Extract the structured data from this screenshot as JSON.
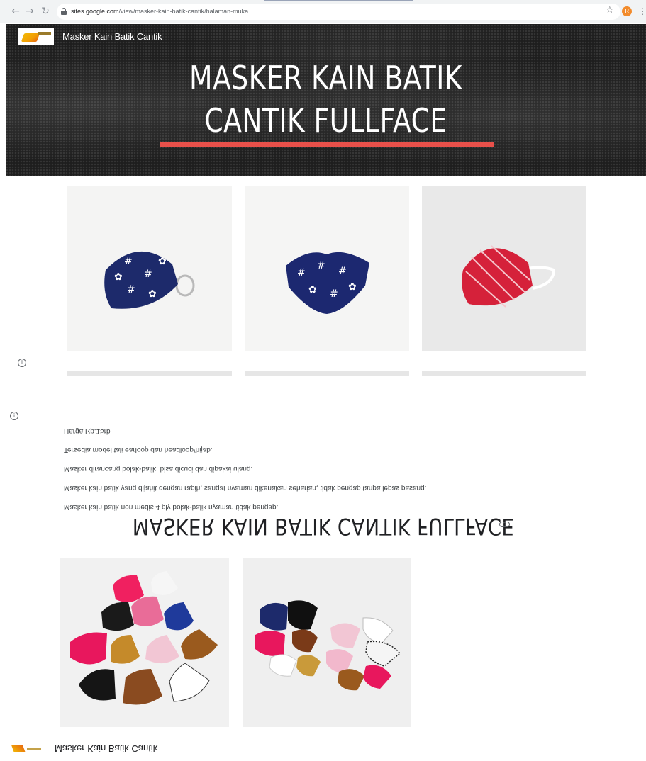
{
  "browser": {
    "url_host": "sites.google.com",
    "url_path": "/view/masker-kain-batik-cantik/halaman-muka",
    "profile_initial": "R",
    "nav_icons": [
      "back-arrow-icon",
      "forward-arrow-icon",
      "reload-icon",
      "lock-icon",
      "star-icon",
      "kebab-menu-icon"
    ]
  },
  "header": {
    "site_title": "Masker Kain Batik Cantik",
    "hero_title_line1": "MASKER KAIN BATIK",
    "hero_title_line2": "CANTIK FULLFACE",
    "accent_color": "#e8504a"
  },
  "products": [
    {
      "label": "navy batik mask with ring ear loop"
    },
    {
      "label": "navy batik mask flat"
    },
    {
      "label": "red parang batik mask"
    }
  ],
  "content": {
    "heading": "MASKER KAIN BATIK CANTIK FULLFACE",
    "descriptions": [
      "Masker kain batik non medis 4 ply bolak-balik nyaman tidak pengap.",
      "Masker kain batik yang dijahit dengan rapih, sangat nyaman dikenakan seharian, tidak pengap tanpa lepas pasang.",
      "Masker dirancang bolak-balik, bisa dicuci dan dipakai ulang.",
      "Tersedia model tali earloop dan headloop/hijab.",
      "Harga Rp.15rb"
    ]
  },
  "footer": {
    "site_title": "Masker Kain Batik Cantik"
  }
}
